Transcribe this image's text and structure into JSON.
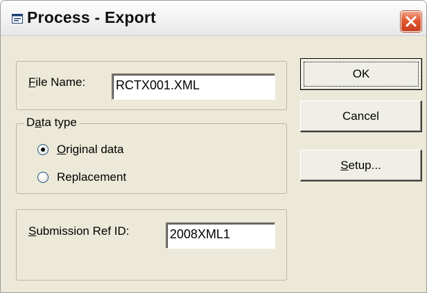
{
  "window": {
    "title": "Process - Export"
  },
  "file": {
    "label_hotkey": "F",
    "label_rest": "ile Name:",
    "value": "RCTX001.XML"
  },
  "data_type": {
    "legend_pre": "D",
    "legend_hotkey": "a",
    "legend_rest": "ta type",
    "options": [
      {
        "hotkey": "O",
        "rest": "riginal data",
        "selected": true
      },
      {
        "hotkey": "",
        "rest": "Replacement",
        "selected": false
      }
    ]
  },
  "submission": {
    "label_hotkey": "S",
    "label_rest": "ubmission Ref ID:",
    "value": "2008XML1"
  },
  "buttons": {
    "ok": "OK",
    "cancel": "Cancel",
    "setup_hotkey": "S",
    "setup_rest": "etup..."
  },
  "icons": {
    "title": "dialog-window-icon",
    "close": "close-icon"
  },
  "colors": {
    "dialog_bg": "#ece9d8",
    "close_button": "#e2582f"
  }
}
